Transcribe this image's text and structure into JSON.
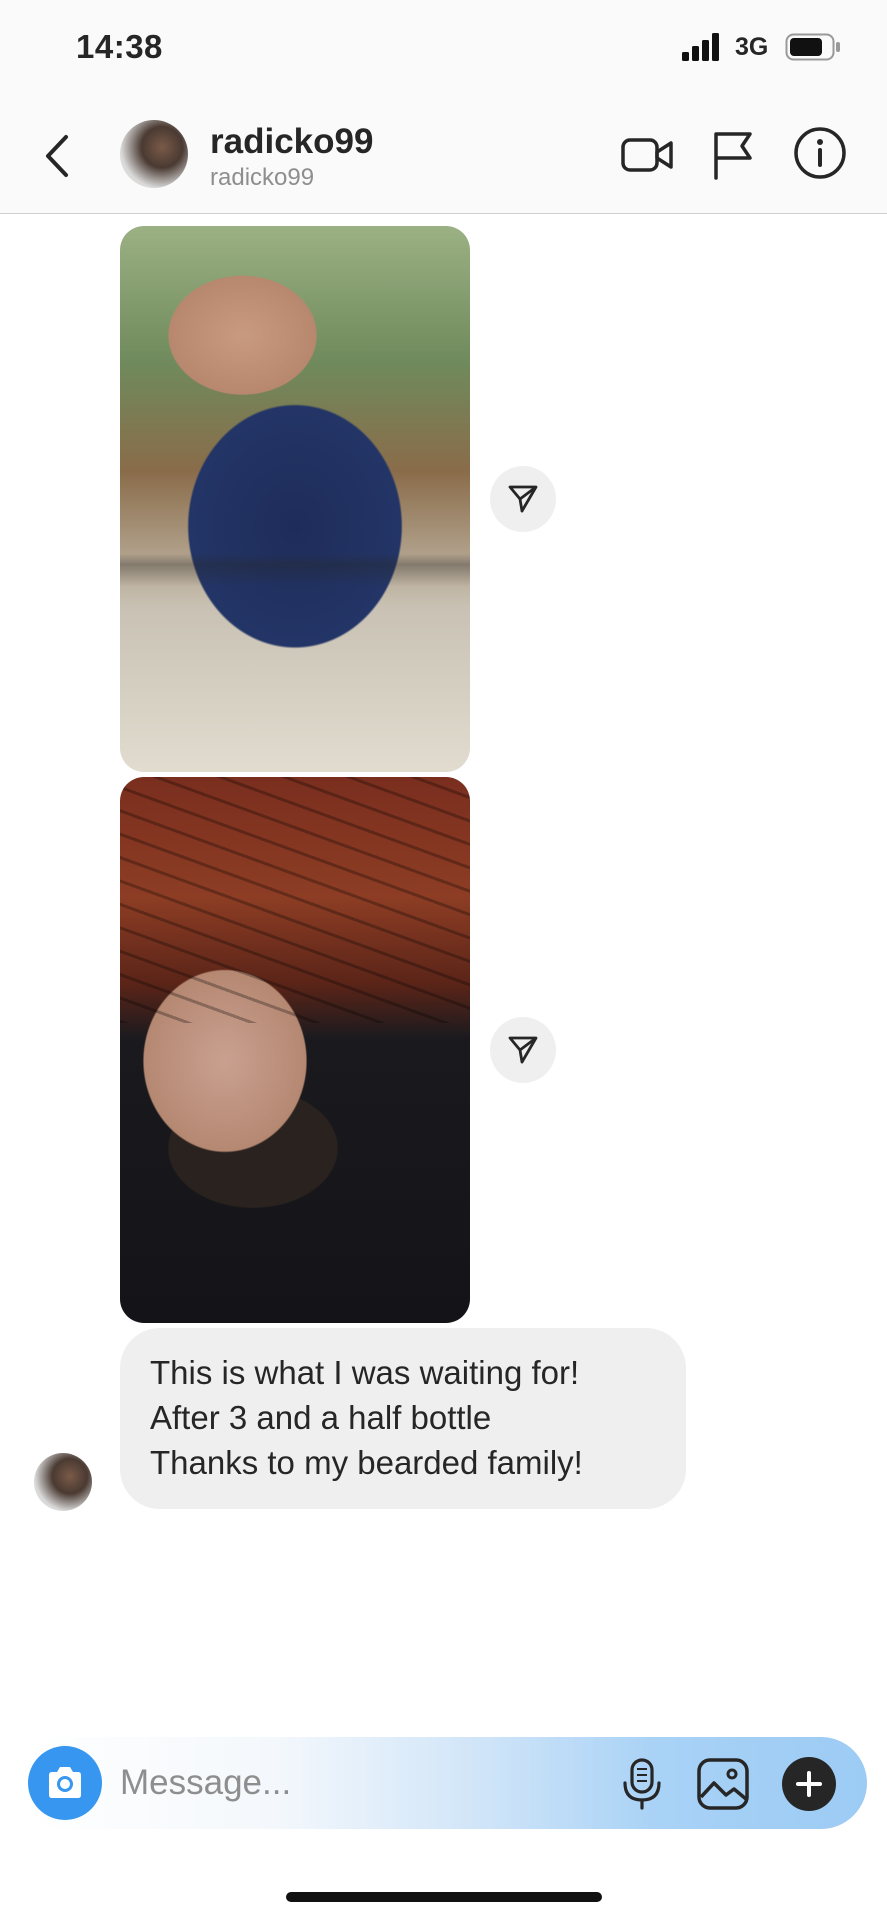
{
  "status_bar": {
    "time": "14:38",
    "network": "3G"
  },
  "header": {
    "username": "radicko99",
    "handle": "radicko99"
  },
  "icons": {
    "back": "chevron-left-icon",
    "video": "video-camera-icon",
    "flag": "flag-icon",
    "info": "info-icon",
    "share": "paper-plane-icon",
    "camera": "camera-icon",
    "mic": "microphone-icon",
    "gallery": "image-icon",
    "plus": "plus-icon"
  },
  "messages": [
    {
      "type": "photo",
      "description": ""
    },
    {
      "type": "photo",
      "description": ""
    },
    {
      "type": "text",
      "lines": [
        "This is what I was waiting for!",
        "After 3 and a half bottle",
        "Thanks to my bearded family!"
      ]
    }
  ],
  "composer": {
    "placeholder": "Message..."
  },
  "colors": {
    "accent": "#3797f0",
    "bubble": "#efefef",
    "text": "#262626",
    "muted": "#8e8e8e"
  }
}
